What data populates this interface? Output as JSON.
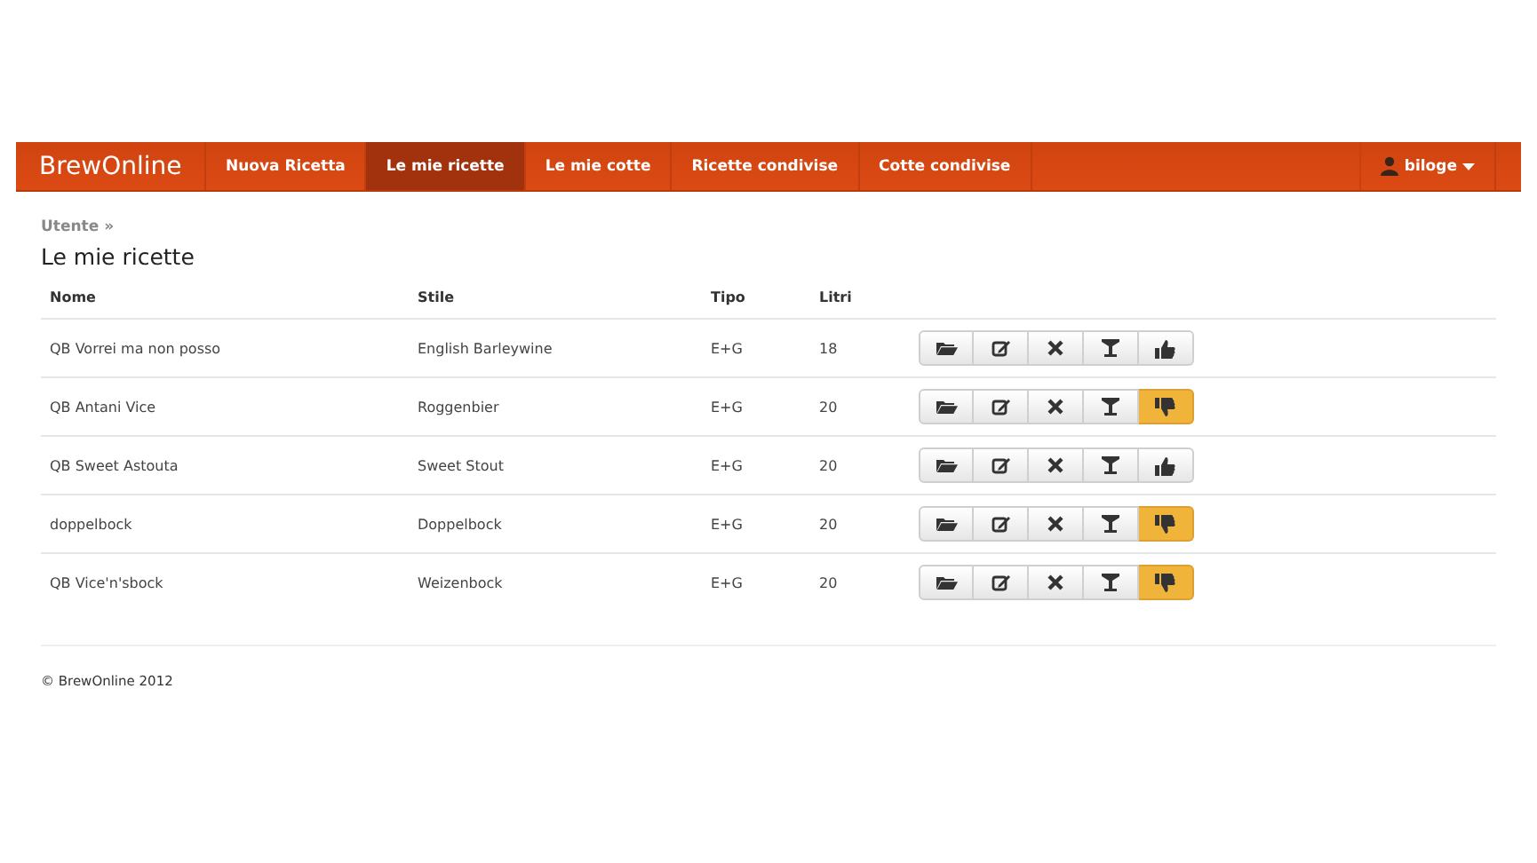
{
  "navbar": {
    "brand": "BrewOnline",
    "items": [
      {
        "label": "Nuova Ricetta",
        "selected": false
      },
      {
        "label": "Le mie ricette",
        "selected": true
      },
      {
        "label": "Le mie cotte",
        "selected": false
      },
      {
        "label": "Ricette condivise",
        "selected": false
      },
      {
        "label": "Cotte condivise",
        "selected": false
      }
    ],
    "user": "biloge"
  },
  "breadcrumb": "Utente »",
  "title": "Le mie ricette",
  "table": {
    "columns": [
      "Nome",
      "Stile",
      "Tipo",
      "Litri"
    ],
    "rows": [
      {
        "cells": [
          "QB Vorrei ma non posso",
          "English Barleywine",
          "E+G",
          "18"
        ],
        "shared": false
      },
      {
        "cells": [
          "QB Antani Vice",
          "Roggenbier",
          "E+G",
          "20"
        ],
        "shared": true
      },
      {
        "cells": [
          "QB Sweet Astouta",
          "Sweet Stout",
          "E+G",
          "20"
        ],
        "shared": false
      },
      {
        "cells": [
          "doppelbock",
          "Doppelbock",
          "E+G",
          "20"
        ],
        "shared": true
      },
      {
        "cells": [
          "QB Vice'n'sbock",
          "Weizenbock",
          "E+G",
          "20"
        ],
        "shared": true
      }
    ]
  },
  "footer": "© BrewOnline 2012"
}
